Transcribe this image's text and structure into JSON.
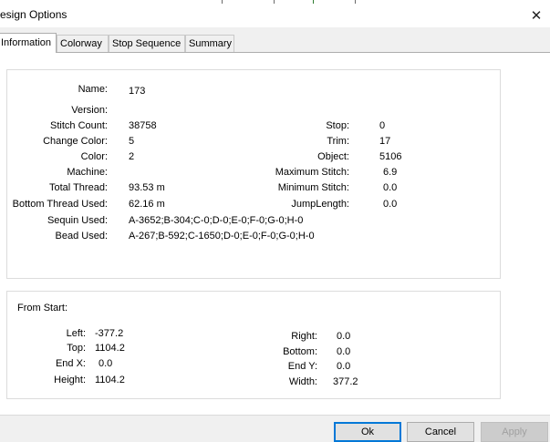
{
  "window": {
    "title": "esign Options",
    "close_glyph": "✕"
  },
  "tabs": [
    "Information",
    "Colorway",
    "Stop Sequence",
    "Summary"
  ],
  "info": {
    "left": [
      {
        "label": "Name:",
        "value": "173"
      },
      {
        "label": "Version:",
        "value": ""
      },
      {
        "label": "Stitch Count:",
        "value": "38758"
      },
      {
        "label": "Change Color:",
        "value": "5"
      },
      {
        "label": "Color:",
        "value": "2"
      },
      {
        "label": "Machine:",
        "value": ""
      },
      {
        "label": "Total Thread:",
        "value": "93.53 m"
      },
      {
        "label": "Bottom Thread Used:",
        "value": "62.16 m"
      },
      {
        "label": "Sequin Used:",
        "value": "A-3652;B-304;C-0;D-0;E-0;F-0;G-0;H-0"
      },
      {
        "label": "Bead Used:",
        "value": "A-267;B-592;C-1650;D-0;E-0;F-0;G-0;H-0"
      }
    ],
    "right": [
      {
        "label": "Stop:",
        "value": "0"
      },
      {
        "label": "Trim:",
        "value": "17"
      },
      {
        "label": "Object:",
        "value": "5106"
      },
      {
        "label": "Maximum Stitch:",
        "value": "6.9"
      },
      {
        "label": "Minimum Stitch:",
        "value": "0.0"
      },
      {
        "label": "JumpLength:",
        "value": "0.0"
      }
    ]
  },
  "from_start": {
    "heading": "From Start:",
    "left": [
      {
        "label": "Left:",
        "value": "-377.2"
      },
      {
        "label": "Top:",
        "value": "1104.2"
      },
      {
        "label": "End X:",
        "value": "0.0"
      },
      {
        "label": "Height:",
        "value": "1104.2"
      }
    ],
    "right": [
      {
        "label": "Right:",
        "value": "0.0"
      },
      {
        "label": "Bottom:",
        "value": "0.0"
      },
      {
        "label": "End Y:",
        "value": "0.0"
      },
      {
        "label": "Width:",
        "value": "377.2"
      }
    ]
  },
  "buttons": {
    "ok": "Ok",
    "cancel": "Cancel",
    "apply": "Apply"
  }
}
